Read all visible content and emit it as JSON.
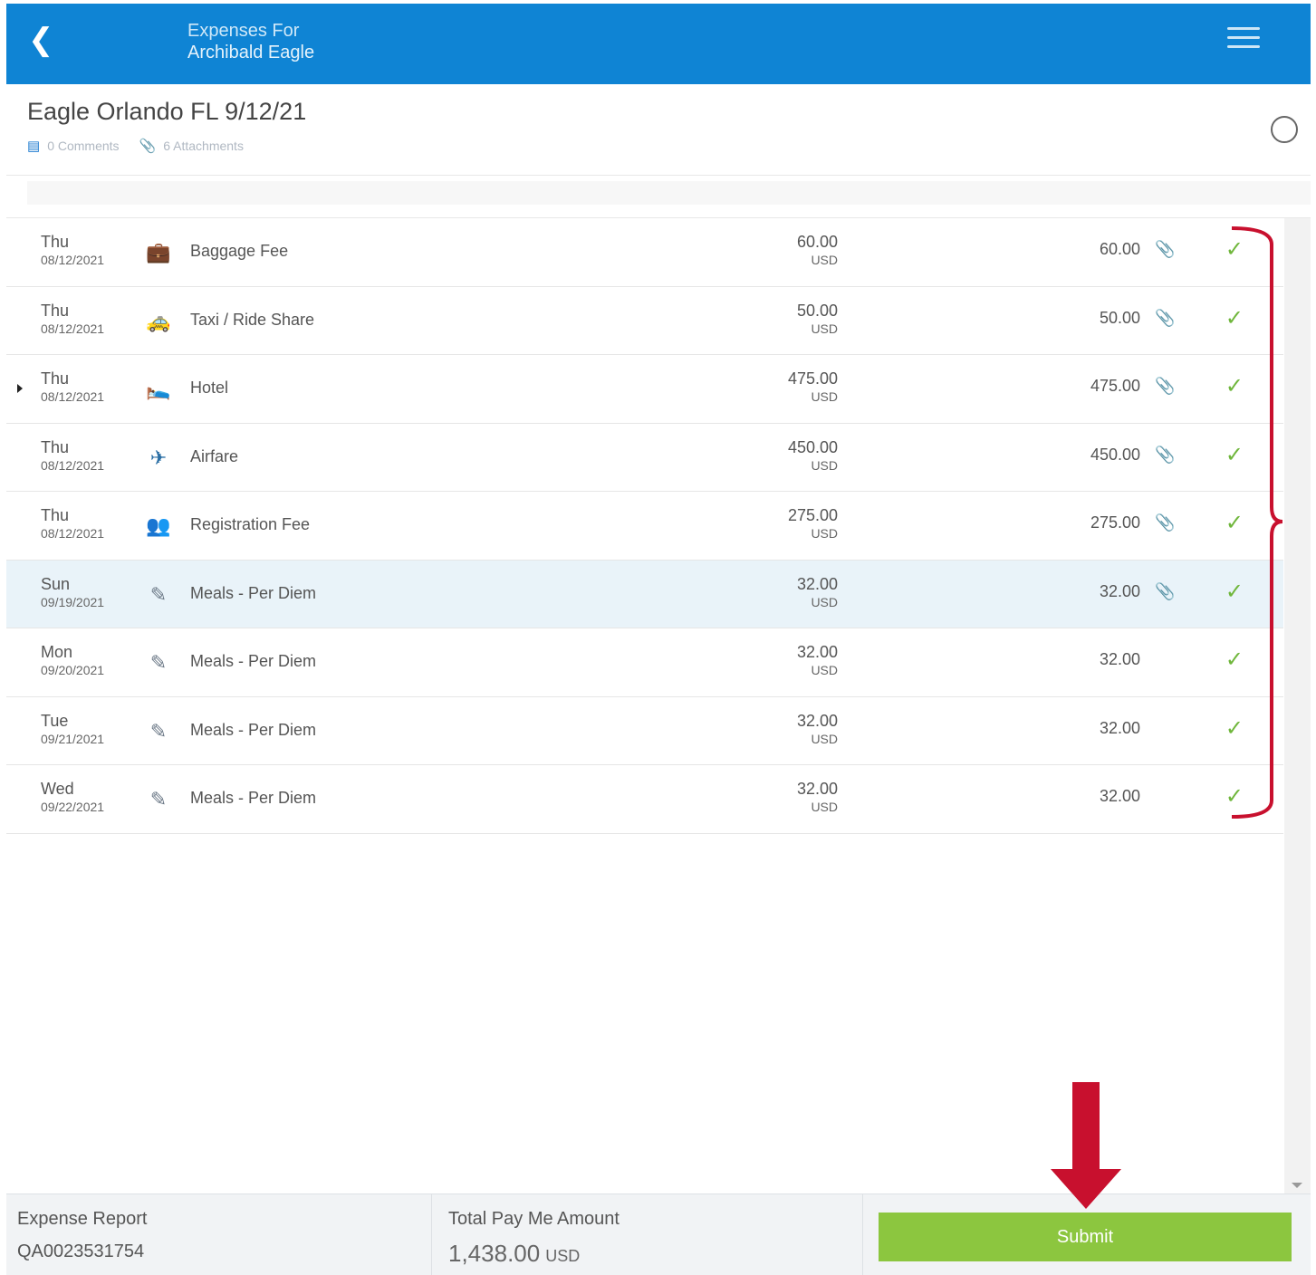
{
  "header": {
    "back_label": "",
    "title_line1": "Expenses For",
    "title_line2": "Archibald Eagle"
  },
  "report": {
    "title": "Eagle Orlando FL 9/12/21",
    "comments": "0 Comments",
    "attachments": "6 Attachments"
  },
  "expenses": [
    {
      "day": "Thu",
      "date": "08/12/2021",
      "type": "Baggage Fee",
      "icon": "briefcase-icon",
      "amount": "60.00",
      "currency": "USD",
      "approved": "60.00",
      "attachment": true,
      "status": "approved"
    },
    {
      "day": "Thu",
      "date": "08/12/2021",
      "type": "Taxi / Ride Share",
      "icon": "taxi-icon",
      "amount": "50.00",
      "currency": "USD",
      "approved": "50.00",
      "attachment": true,
      "status": "approved"
    },
    {
      "day": "Thu",
      "date": "08/12/2021",
      "type": "Hotel",
      "icon": "bed-icon",
      "amount": "475.00",
      "currency": "USD",
      "approved": "475.00",
      "attachment": true,
      "status": "approved"
    },
    {
      "day": "Thu",
      "date": "08/12/2021",
      "type": "Airfare",
      "icon": "airplane-icon",
      "amount": "450.00",
      "currency": "USD",
      "approved": "450.00",
      "attachment": true,
      "status": "approved"
    },
    {
      "day": "Thu",
      "date": "08/12/2021",
      "type": "Registration Fee",
      "icon": "registration-icon",
      "amount": "275.00",
      "currency": "USD",
      "approved": "275.00",
      "attachment": true,
      "status": "approved"
    },
    {
      "day": "Sun",
      "date": "09/19/2021",
      "type": "Meals - Per Diem",
      "icon": "meals-icon",
      "amount": "32.00",
      "currency": "USD",
      "approved": "32.00",
      "attachment": true,
      "status": "approved"
    },
    {
      "day": "Mon",
      "date": "09/20/2021",
      "type": "Meals - Per Diem",
      "icon": "meals-icon",
      "amount": "32.00",
      "currency": "USD",
      "approved": "32.00",
      "attachment": false,
      "status": "approved"
    },
    {
      "day": "Tue",
      "date": "09/21/2021",
      "type": "Meals - Per Diem",
      "icon": "meals-icon",
      "amount": "32.00",
      "currency": "USD",
      "approved": "32.00",
      "attachment": false,
      "status": "approved"
    },
    {
      "day": "Wed",
      "date": "09/22/2021",
      "type": "Meals - Per Diem",
      "icon": "meals-icon",
      "amount": "32.00",
      "currency": "USD",
      "approved": "32.00",
      "attachment": false,
      "status": "approved"
    }
  ],
  "footer": {
    "report_label": "Expense Report",
    "report_id": "QA0023531754",
    "total_label": "Total Pay Me Amount",
    "total_value": "1,438.00",
    "total_currency": "USD",
    "submit_label": "Submit"
  },
  "colors": {
    "header_bg": "#0f84d4",
    "submit_bg": "#8cc63f",
    "check": "#6fb63b",
    "annotation": "#c8102e"
  }
}
